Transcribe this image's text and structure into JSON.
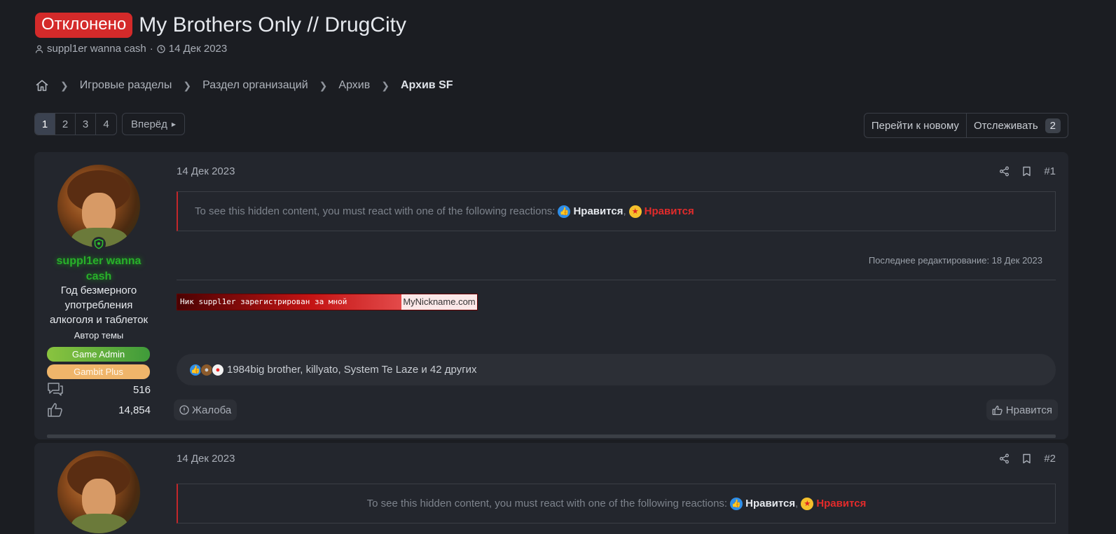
{
  "thread": {
    "status_badge": "Отклонено",
    "title": "My Brothers Only // DrugCity",
    "author": "suppl1er wanna cash",
    "meta_sep": "·",
    "date": "14 Дек 2023"
  },
  "breadcrumb": [
    "Игровые разделы",
    "Раздел организаций",
    "Архив",
    "Архив SF"
  ],
  "pagination": {
    "pages": [
      "1",
      "2",
      "3",
      "4"
    ],
    "current": "1",
    "next_label": "Вперёд"
  },
  "actions": {
    "go_new": "Перейти к новому",
    "watch": "Отслеживать",
    "watch_count": "2"
  },
  "posts": [
    {
      "date": "14 Дек 2023",
      "number": "#1",
      "username": "suppl1er wanna cash",
      "user_title": "Год безмерного употребления алкоголя и таблеток",
      "author_label": "Автор темы",
      "badges": [
        "Game Admin",
        "Gambit Plus"
      ],
      "messages": "516",
      "likes": "14,854",
      "hidden_text": "To see this hidden content, you must react with one of the following reactions:",
      "reaction1": "Нравится",
      "reaction_sep": ",",
      "reaction2": "Нравится",
      "edited": "Последнее редактирование: 18 Дек 2023",
      "banner_text": "Ник suppl1er зарегистрирован за мной",
      "banner_site": "MyNickname.com",
      "reacted_by": "1984big brother, killyato, System Te Laze и 42 других",
      "report": "Жалоба",
      "like": "Нравится"
    },
    {
      "date": "14 Дек 2023",
      "number": "#2",
      "hidden_text": "To see this hidden content, you must react with one of the following reactions:",
      "reaction1": "Нравится",
      "reaction_sep": ",",
      "reaction2": "Нравится"
    }
  ]
}
